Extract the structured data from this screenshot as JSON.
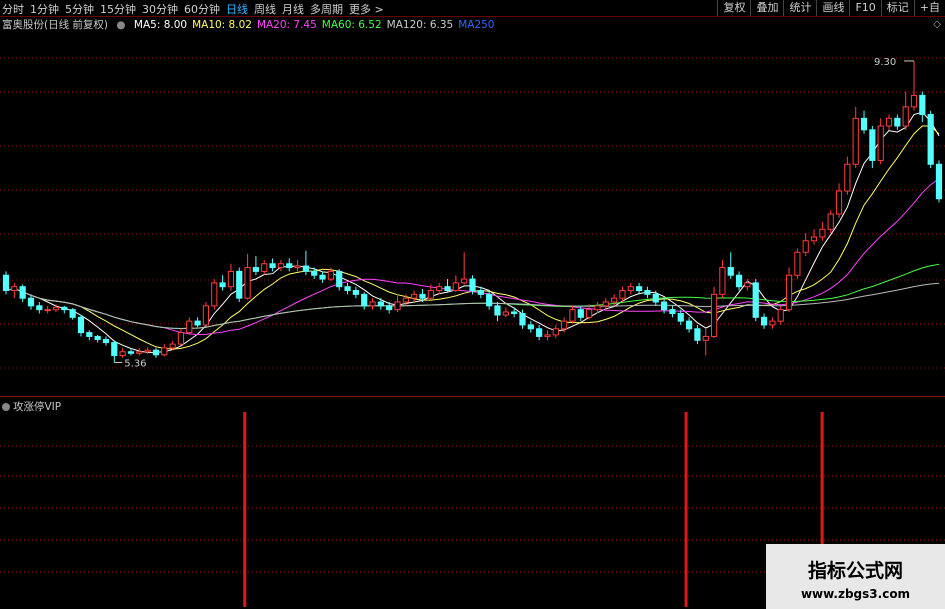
{
  "toolbar": {
    "periods": [
      {
        "label": "分时",
        "active": false
      },
      {
        "label": "1分钟",
        "active": false
      },
      {
        "label": "5分钟",
        "active": false
      },
      {
        "label": "15分钟",
        "active": false
      },
      {
        "label": "30分钟",
        "active": false
      },
      {
        "label": "60分钟",
        "active": false
      },
      {
        "label": "日线",
        "active": true
      },
      {
        "label": "周线",
        "active": false
      },
      {
        "label": "月线",
        "active": false
      },
      {
        "label": "多周期",
        "active": false
      },
      {
        "label": "更多 >",
        "active": false
      }
    ],
    "tools": [
      "复权",
      "叠加",
      "统计",
      "画线",
      "F10",
      "标记",
      "+自"
    ]
  },
  "legend": {
    "stock": "富奥股份(日线 前复权)",
    "ma": [
      {
        "label": "MA5: 8.00",
        "color": "#ffffff"
      },
      {
        "label": "MA10: 8.02",
        "color": "#ffff66"
      },
      {
        "label": "MA20: 7.45",
        "color": "#ff44ff"
      },
      {
        "label": "MA60: 6.52",
        "color": "#44ff44"
      },
      {
        "label": "MA120: 6.35",
        "color": "#cccccc"
      },
      {
        "label": "MA250",
        "color": "#3366ff"
      }
    ]
  },
  "chart_data": {
    "type": "candlestick",
    "ylim": [
      5.0,
      9.6
    ],
    "high_label": "9.30",
    "low_label": "5.36",
    "candles": [
      [
        6.5,
        6.3,
        6.55,
        6.25
      ],
      [
        6.3,
        6.35,
        6.4,
        6.2
      ],
      [
        6.35,
        6.2,
        6.38,
        6.15
      ],
      [
        6.2,
        6.1,
        6.25,
        6.05
      ],
      [
        6.1,
        6.05,
        6.15,
        6.0
      ],
      [
        6.05,
        6.05,
        6.1,
        6.0
      ],
      [
        6.05,
        6.08,
        6.12,
        6.02
      ],
      [
        6.08,
        6.05,
        6.1,
        6.0
      ],
      [
        6.05,
        5.95,
        6.07,
        5.92
      ],
      [
        5.95,
        5.75,
        5.98,
        5.7
      ],
      [
        5.75,
        5.7,
        5.78,
        5.65
      ],
      [
        5.7,
        5.66,
        5.72,
        5.62
      ],
      [
        5.66,
        5.62,
        5.7,
        5.58
      ],
      [
        5.62,
        5.45,
        5.65,
        5.36
      ],
      [
        5.45,
        5.5,
        5.55,
        5.42
      ],
      [
        5.5,
        5.48,
        5.55,
        5.45
      ],
      [
        5.48,
        5.5,
        5.55,
        5.45
      ],
      [
        5.5,
        5.52,
        5.56,
        5.47
      ],
      [
        5.52,
        5.46,
        5.55,
        5.42
      ],
      [
        5.46,
        5.55,
        5.6,
        5.44
      ],
      [
        5.55,
        5.6,
        5.64,
        5.52
      ],
      [
        5.6,
        5.75,
        5.8,
        5.58
      ],
      [
        5.75,
        5.9,
        5.95,
        5.72
      ],
      [
        5.9,
        5.85,
        5.95,
        5.82
      ],
      [
        5.85,
        6.1,
        6.15,
        5.83
      ],
      [
        6.1,
        6.4,
        6.45,
        6.05
      ],
      [
        6.4,
        6.35,
        6.5,
        6.3
      ],
      [
        6.35,
        6.55,
        6.65,
        6.3
      ],
      [
        6.55,
        6.2,
        6.6,
        6.15
      ],
      [
        6.2,
        6.6,
        6.78,
        6.18
      ],
      [
        6.6,
        6.55,
        6.75,
        6.5
      ],
      [
        6.55,
        6.65,
        6.7,
        6.5
      ],
      [
        6.65,
        6.6,
        6.72,
        6.55
      ],
      [
        6.6,
        6.65,
        6.7,
        6.55
      ],
      [
        6.65,
        6.6,
        6.72,
        6.55
      ],
      [
        6.6,
        6.62,
        6.7,
        6.55
      ],
      [
        6.62,
        6.55,
        6.82,
        6.5
      ],
      [
        6.55,
        6.5,
        6.6,
        6.45
      ],
      [
        6.5,
        6.45,
        6.55,
        6.4
      ],
      [
        6.45,
        6.55,
        6.6,
        6.42
      ],
      [
        6.55,
        6.35,
        6.58,
        6.3
      ],
      [
        6.35,
        6.3,
        6.4,
        6.25
      ],
      [
        6.3,
        6.25,
        6.35,
        6.2
      ],
      [
        6.25,
        6.1,
        6.28,
        6.05
      ],
      [
        6.1,
        6.15,
        6.2,
        6.05
      ],
      [
        6.15,
        6.1,
        6.2,
        6.05
      ],
      [
        6.1,
        6.05,
        6.15,
        6.0
      ],
      [
        6.05,
        6.15,
        6.25,
        6.02
      ],
      [
        6.15,
        6.2,
        6.25,
        6.1
      ],
      [
        6.2,
        6.25,
        6.3,
        6.15
      ],
      [
        6.25,
        6.2,
        6.32,
        6.15
      ],
      [
        6.2,
        6.3,
        6.38,
        6.18
      ],
      [
        6.3,
        6.35,
        6.4,
        6.25
      ],
      [
        6.35,
        6.3,
        6.45,
        6.28
      ],
      [
        6.3,
        6.4,
        6.5,
        6.28
      ],
      [
        6.4,
        6.45,
        6.8,
        6.38
      ],
      [
        6.45,
        6.3,
        6.5,
        6.25
      ],
      [
        6.3,
        6.25,
        6.35,
        6.2
      ],
      [
        6.25,
        6.1,
        6.3,
        6.05
      ],
      [
        6.1,
        5.98,
        6.15,
        5.9
      ],
      [
        5.98,
        6.02,
        6.08,
        5.95
      ],
      [
        6.02,
        6.0,
        6.08,
        5.95
      ],
      [
        6.0,
        5.85,
        6.05,
        5.8
      ],
      [
        5.85,
        5.8,
        5.9,
        5.75
      ],
      [
        5.8,
        5.7,
        5.85,
        5.65
      ],
      [
        5.7,
        5.72,
        5.78,
        5.65
      ],
      [
        5.72,
        5.8,
        5.85,
        5.68
      ],
      [
        5.8,
        5.9,
        5.95,
        5.75
      ],
      [
        5.9,
        6.05,
        6.1,
        5.88
      ],
      [
        6.05,
        5.95,
        6.1,
        5.9
      ],
      [
        5.95,
        6.05,
        6.12,
        5.92
      ],
      [
        6.05,
        6.1,
        6.15,
        6.0
      ],
      [
        6.1,
        6.15,
        6.2,
        6.05
      ],
      [
        6.15,
        6.2,
        6.25,
        6.1
      ],
      [
        6.2,
        6.3,
        6.35,
        6.15
      ],
      [
        6.3,
        6.35,
        6.4,
        6.25
      ],
      [
        6.35,
        6.3,
        6.4,
        6.25
      ],
      [
        6.3,
        6.25,
        6.35,
        6.2
      ],
      [
        6.25,
        6.15,
        6.3,
        6.1
      ],
      [
        6.15,
        6.05,
        6.2,
        6.0
      ],
      [
        6.05,
        6.0,
        6.1,
        5.95
      ],
      [
        6.0,
        5.9,
        6.05,
        5.85
      ],
      [
        5.9,
        5.8,
        5.95,
        5.75
      ],
      [
        5.8,
        5.65,
        5.85,
        5.6
      ],
      [
        5.65,
        5.7,
        5.8,
        5.45
      ],
      [
        5.7,
        6.25,
        6.35,
        5.68
      ],
      [
        6.25,
        6.6,
        6.7,
        6.2
      ],
      [
        6.6,
        6.5,
        6.8,
        6.45
      ],
      [
        6.5,
        6.35,
        6.55,
        6.3
      ],
      [
        6.35,
        6.4,
        6.45,
        6.3
      ],
      [
        6.4,
        5.95,
        6.45,
        5.9
      ],
      [
        5.95,
        5.85,
        6.0,
        5.8
      ],
      [
        5.85,
        5.9,
        5.95,
        5.8
      ],
      [
        5.9,
        6.05,
        6.1,
        5.85
      ],
      [
        6.05,
        6.5,
        6.6,
        6.02
      ],
      [
        6.5,
        6.8,
        6.85,
        6.45
      ],
      [
        6.8,
        6.95,
        7.05,
        6.75
      ],
      [
        6.95,
        7.0,
        7.1,
        6.9
      ],
      [
        7.0,
        7.1,
        7.2,
        6.95
      ],
      [
        7.1,
        7.3,
        7.35,
        7.05
      ],
      [
        7.3,
        7.6,
        7.7,
        7.25
      ],
      [
        7.6,
        7.95,
        8.05,
        7.55
      ],
      [
        7.95,
        8.55,
        8.7,
        7.9
      ],
      [
        8.55,
        8.4,
        8.65,
        8.35
      ],
      [
        8.4,
        8.0,
        8.45,
        7.9
      ],
      [
        8.0,
        8.45,
        8.55,
        7.95
      ],
      [
        8.45,
        8.55,
        8.6,
        8.4
      ],
      [
        8.55,
        8.45,
        8.6,
        8.4
      ],
      [
        8.45,
        8.7,
        8.9,
        8.4
      ],
      [
        8.7,
        8.85,
        9.3,
        8.65
      ],
      [
        8.85,
        8.6,
        8.9,
        8.5
      ],
      [
        8.6,
        7.95,
        8.65,
        7.9
      ],
      [
        7.95,
        7.5,
        8.0,
        7.45
      ]
    ],
    "ind_panel": {
      "label": "攻涨停VIP",
      "signal_positions": [
        0.259,
        0.726,
        0.87
      ]
    }
  }
}
